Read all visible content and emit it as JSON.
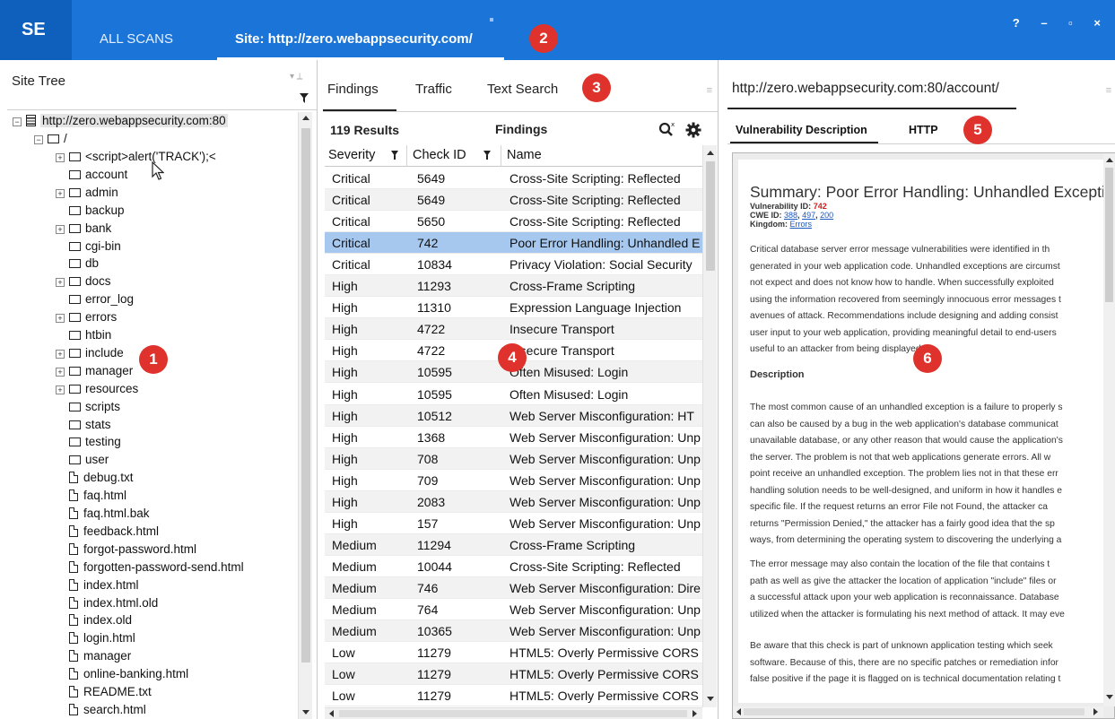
{
  "app": {
    "logo": "SE",
    "tabs": [
      {
        "label": "ALL SCANS"
      },
      {
        "label": "Site: http://zero.webappsecurity.com/"
      }
    ],
    "window_controls": "? – ▫ ×"
  },
  "badges": [
    "1",
    "2",
    "3",
    "4",
    "5",
    "6"
  ],
  "site_tree": {
    "title": "Site Tree",
    "root": "http://zero.webappsecurity.com:80",
    "root_child": "/",
    "items": [
      {
        "label": "<script>alert('TRACK');<",
        "type": "folder",
        "expandable": true
      },
      {
        "label": "account",
        "type": "folder",
        "expandable": false
      },
      {
        "label": "admin",
        "type": "folder",
        "expandable": true
      },
      {
        "label": "backup",
        "type": "folder",
        "expandable": false
      },
      {
        "label": "bank",
        "type": "folder",
        "expandable": true
      },
      {
        "label": "cgi-bin",
        "type": "folder",
        "expandable": false
      },
      {
        "label": "db",
        "type": "folder",
        "expandable": false
      },
      {
        "label": "docs",
        "type": "folder",
        "expandable": true
      },
      {
        "label": "error_log",
        "type": "folder",
        "expandable": false
      },
      {
        "label": "errors",
        "type": "folder",
        "expandable": true
      },
      {
        "label": "htbin",
        "type": "folder",
        "expandable": false
      },
      {
        "label": "include",
        "type": "folder",
        "expandable": true
      },
      {
        "label": "manager",
        "type": "folder",
        "expandable": true
      },
      {
        "label": "resources",
        "type": "folder",
        "expandable": true
      },
      {
        "label": "scripts",
        "type": "folder",
        "expandable": false
      },
      {
        "label": "stats",
        "type": "folder",
        "expandable": false
      },
      {
        "label": "testing",
        "type": "folder",
        "expandable": false
      },
      {
        "label": "user",
        "type": "folder",
        "expandable": false
      },
      {
        "label": "debug.txt",
        "type": "file"
      },
      {
        "label": "faq.html",
        "type": "file"
      },
      {
        "label": "faq.html.bak",
        "type": "file"
      },
      {
        "label": "feedback.html",
        "type": "file"
      },
      {
        "label": "forgot-password.html",
        "type": "file"
      },
      {
        "label": "forgotten-password-send.html",
        "type": "file"
      },
      {
        "label": "index.html",
        "type": "file"
      },
      {
        "label": "index.html.old",
        "type": "file"
      },
      {
        "label": "index.old",
        "type": "file"
      },
      {
        "label": "login.html",
        "type": "file"
      },
      {
        "label": "manager",
        "type": "file"
      },
      {
        "label": "online-banking.html",
        "type": "file"
      },
      {
        "label": "README.txt",
        "type": "file"
      },
      {
        "label": "search.html",
        "type": "file"
      }
    ]
  },
  "findings_panel": {
    "tabs": [
      {
        "label": "Findings"
      },
      {
        "label": "Traffic"
      },
      {
        "label": "Text Search"
      }
    ],
    "result_count": "119 Results",
    "header_label": "Findings",
    "columns": [
      "Severity",
      "Check ID",
      "Name"
    ],
    "selected_index": 3,
    "rows": [
      {
        "severity": "Critical",
        "check_id": "5649",
        "name": "Cross-Site Scripting: Reflected"
      },
      {
        "severity": "Critical",
        "check_id": "5649",
        "name": "Cross-Site Scripting: Reflected"
      },
      {
        "severity": "Critical",
        "check_id": "5650",
        "name": "Cross-Site Scripting: Reflected"
      },
      {
        "severity": "Critical",
        "check_id": "742",
        "name": "Poor Error Handling: Unhandled E"
      },
      {
        "severity": "Critical",
        "check_id": "10834",
        "name": "Privacy Violation: Social Security"
      },
      {
        "severity": "High",
        "check_id": "11293",
        "name": "Cross-Frame Scripting"
      },
      {
        "severity": "High",
        "check_id": "11310",
        "name": "Expression Language Injection"
      },
      {
        "severity": "High",
        "check_id": "4722",
        "name": "Insecure Transport"
      },
      {
        "severity": "High",
        "check_id": "4722",
        "name": "Insecure Transport"
      },
      {
        "severity": "High",
        "check_id": "10595",
        "name": "Often Misused: Login"
      },
      {
        "severity": "High",
        "check_id": "10595",
        "name": "Often Misused: Login"
      },
      {
        "severity": "High",
        "check_id": "10512",
        "name": "Web Server Misconfiguration: HT"
      },
      {
        "severity": "High",
        "check_id": "1368",
        "name": "Web Server Misconfiguration: Unp"
      },
      {
        "severity": "High",
        "check_id": "708",
        "name": "Web Server Misconfiguration: Unp"
      },
      {
        "severity": "High",
        "check_id": "709",
        "name": "Web Server Misconfiguration: Unp"
      },
      {
        "severity": "High",
        "check_id": "2083",
        "name": "Web Server Misconfiguration: Unp"
      },
      {
        "severity": "High",
        "check_id": "157",
        "name": "Web Server Misconfiguration: Unp"
      },
      {
        "severity": "Medium",
        "check_id": "11294",
        "name": "Cross-Frame Scripting"
      },
      {
        "severity": "Medium",
        "check_id": "10044",
        "name": "Cross-Site Scripting: Reflected"
      },
      {
        "severity": "Medium",
        "check_id": "746",
        "name": "Web Server Misconfiguration: Dire"
      },
      {
        "severity": "Medium",
        "check_id": "764",
        "name": "Web Server Misconfiguration: Unp"
      },
      {
        "severity": "Medium",
        "check_id": "10365",
        "name": "Web Server Misconfiguration: Unp"
      },
      {
        "severity": "Low",
        "check_id": "11279",
        "name": "HTML5: Overly Permissive CORS"
      },
      {
        "severity": "Low",
        "check_id": "11279",
        "name": "HTML5: Overly Permissive CORS"
      },
      {
        "severity": "Low",
        "check_id": "11279",
        "name": "HTML5: Overly Permissive CORS"
      }
    ]
  },
  "detail_panel": {
    "url": "http://zero.webappsecurity.com:80/account/",
    "tabs": [
      {
        "label": "Vulnerability Description"
      },
      {
        "label": "HTTP"
      }
    ],
    "summary_title": "Summary: Poor Error Handling: Unhandled Exception",
    "vuln_id_label": "Vulnerability ID:",
    "vuln_id": "742",
    "cwe_label": "CWE ID:",
    "cwe_ids": [
      "388",
      "497",
      "200"
    ],
    "kingdom_label": "Kingdom:",
    "kingdom": "Errors",
    "summary_lines": [
      "Critical database server error message vulnerabilities were identified in th",
      "generated in your web application code. Unhandled exceptions are circumst",
      "not expect and does not know how to handle. When successfully exploited",
      "using the information recovered from seemingly innocuous error messages t",
      "avenues of attack. Recommendations include designing and adding consist",
      "user input to your web application, providing meaningful detail to end-users",
      "useful to an attacker from being displayed."
    ],
    "description_heading": "Description",
    "desc_lines_1": [
      "The most common cause of an unhandled exception is a failure to properly s",
      "can also be caused by a bug in the web application's database communicat",
      "unavailable database, or any other reason that would cause the application's",
      "the server. The problem is not that web applications generate errors. All w",
      "point receive an unhandled exception. The problem lies not in that these err",
      "handling solution needs to be well-designed, and uniform in how it handles e",
      "specific file. If the request returns an error File not Found, the attacker ca",
      "returns \"Permission Denied,\" the attacker has a fairly good idea that the sp",
      "ways, from determining the operating system to discovering the underlying a"
    ],
    "desc_lines_2": [
      "The error message may also contain the location of the file that contains t",
      "path as well as give the attacker the location of application \"include\" files or",
      "a successful attack upon your web application is reconnaissance. Database",
      "utilized when the attacker is formulating his next method of attack. It may eve"
    ],
    "desc_lines_3": [
      "Be aware that this check is part of unknown application testing which seek",
      "software. Because of this, there are no specific patches or remediation infor",
      "false positive if the page it is flagged on is technical documentation relating t"
    ]
  },
  "colors": {
    "title_bar": "#1b75d9",
    "logo_bg": "#0f5fbd",
    "badge": "#e0322c",
    "selected_row": "#a6c8ef",
    "link": "#1b58c0"
  }
}
